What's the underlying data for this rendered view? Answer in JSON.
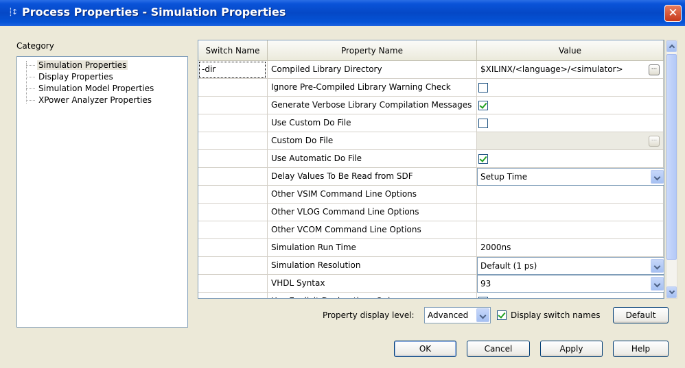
{
  "window": {
    "title": "Process Properties - Simulation Properties",
    "sys_icon": "⸽↕",
    "close_glyph": "✕"
  },
  "category": {
    "label": "Category",
    "items": [
      {
        "label": "Simulation Properties",
        "selected": true
      },
      {
        "label": "Display Properties"
      },
      {
        "label": "Simulation Model Properties"
      },
      {
        "label": "XPower Analyzer Properties"
      }
    ]
  },
  "grid": {
    "headers": {
      "switch": "Switch Name",
      "name": "Property Name",
      "value": "Value"
    },
    "rows": [
      {
        "switch": "-dir",
        "name": "Compiled Library Directory",
        "value": "$XILINX/<language>/<simulator>",
        "kind": "text-browse"
      },
      {
        "switch": "",
        "name": "Ignore Pre-Compiled Library Warning Check",
        "kind": "checkbox",
        "checked": false
      },
      {
        "switch": "",
        "name": "Generate Verbose Library Compilation Messages",
        "kind": "checkbox",
        "checked": true
      },
      {
        "switch": "",
        "name": "Use Custom Do File",
        "kind": "checkbox",
        "checked": false
      },
      {
        "switch": "",
        "name": "Custom Do File",
        "value": "",
        "kind": "disabled-browse"
      },
      {
        "switch": "",
        "name": "Use Automatic Do File",
        "kind": "checkbox",
        "checked": true
      },
      {
        "switch": "",
        "name": "Delay Values To Be Read from SDF",
        "value": "Setup Time",
        "kind": "dropdown"
      },
      {
        "switch": "",
        "name": "Other VSIM Command Line Options",
        "value": "",
        "kind": "text"
      },
      {
        "switch": "",
        "name": "Other VLOG Command Line Options",
        "value": "",
        "kind": "text"
      },
      {
        "switch": "",
        "name": "Other VCOM Command Line Options",
        "value": "",
        "kind": "text"
      },
      {
        "switch": "",
        "name": "Simulation Run Time",
        "value": "2000ns",
        "kind": "text"
      },
      {
        "switch": "",
        "name": "Simulation Resolution",
        "value": "Default (1 ps)",
        "kind": "dropdown"
      },
      {
        "switch": "",
        "name": "VHDL Syntax",
        "value": "93",
        "kind": "dropdown"
      },
      {
        "switch": "",
        "name": "Use Explicit Declarations Only",
        "kind": "checkbox",
        "checked": true
      }
    ]
  },
  "footer": {
    "property_level_label": "Property display level:",
    "property_level_value": "Advanced",
    "display_switch_names_label": "Display switch names",
    "display_switch_names_checked": true,
    "default_button": "Default"
  },
  "buttons": {
    "ok": "OK",
    "cancel": "Cancel",
    "apply": "Apply",
    "help": "Help"
  },
  "colors": {
    "title_bar": "#0548c6",
    "face": "#ece9d8",
    "checkmark": "#21a121",
    "close": "#c6381a"
  }
}
